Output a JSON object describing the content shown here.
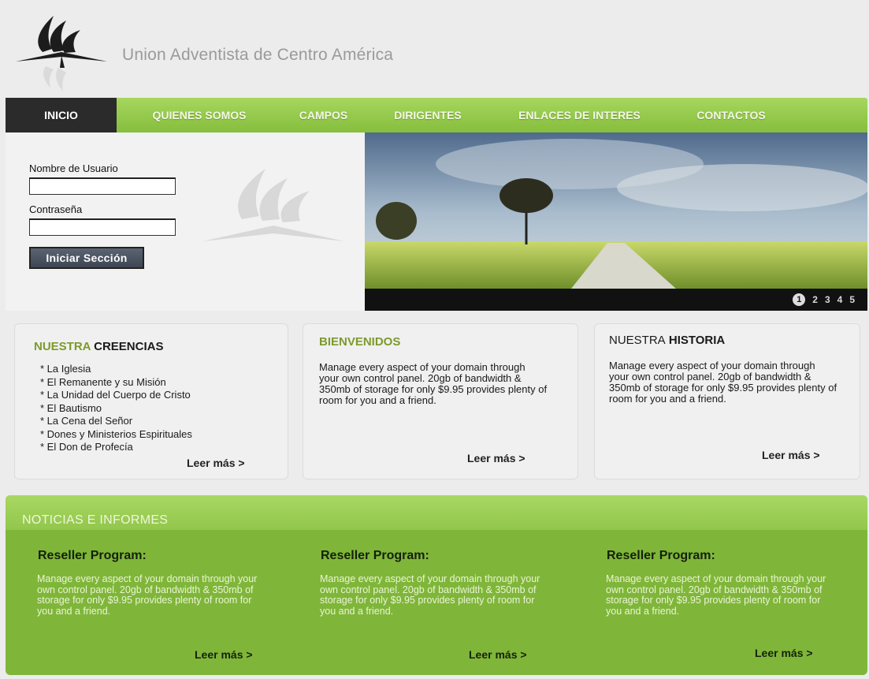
{
  "header": {
    "title": "Union Adventista de Centro América"
  },
  "nav": {
    "items": [
      {
        "label": "INICIO"
      },
      {
        "label": "QUIENES SOMOS"
      },
      {
        "label": "CAMPOS"
      },
      {
        "label": "DIRIGENTES"
      },
      {
        "label": "ENLACES DE INTERES"
      },
      {
        "label": "CONTACTOS"
      }
    ]
  },
  "login": {
    "username_label": "Nombre de Usuario",
    "username_value": "",
    "password_label": "Contraseña",
    "password_value": "",
    "submit_label": "Iniciar Sección"
  },
  "slider": {
    "pages": [
      "1",
      "2",
      "3",
      "4",
      "5"
    ],
    "active": "1"
  },
  "creencias": {
    "title_light": "NUESTRA",
    "title_dark": "CREENCIAS",
    "items": [
      "La Iglesia",
      "El Remanente y su Misión",
      "La Unidad del Cuerpo de Cristo",
      "El Bautismo",
      "La Cena del Señor",
      "Dones y Ministerios Espirituales",
      "El Don de Profecía"
    ],
    "more": "Leer más >"
  },
  "bienvenidos": {
    "title": "BIENVENIDOS",
    "text": "Manage every aspect of your domain through your own control panel. 20gb of bandwidth & 350mb of storage for only $9.95 provides plenty of room for you and a friend.",
    "more": "Leer más >"
  },
  "historia": {
    "title_light": "NUESTRA",
    "title_dark": "HISTORIA",
    "text": "Manage every aspect of your domain through your own control panel. 20gb of bandwidth & 350mb of storage for only $9.95 provides plenty of room for you and a friend.",
    "more": "Leer más >"
  },
  "news": {
    "title": "NOTICIAS E INFORMES",
    "items": [
      {
        "heading": "Reseller Program:",
        "text": "Manage every aspect of your domain through your own control panel. 20gb of bandwidth & 350mb of storage for only $9.95 provides plenty of room for you and a friend.",
        "more": "Leer más >"
      },
      {
        "heading": "Reseller Program:",
        "text": "Manage every aspect of your domain through your own control panel. 20gb of bandwidth & 350mb of storage for only $9.95 provides plenty of room for you and a friend.",
        "more": "Leer más >"
      },
      {
        "heading": "Reseller Program:",
        "text": "Manage every aspect of your domain through your own control panel. 20gb of bandwidth & 350mb of storage for only $9.95 provides plenty of room for you and a friend.",
        "more": "Leer más >"
      }
    ]
  },
  "colors": {
    "accent": "#8dc63f",
    "nav_active": "#2b2b2b",
    "accent_dark": "#7d9a2c"
  },
  "icons": {
    "logo": "adventist-flame-bible-logo"
  }
}
